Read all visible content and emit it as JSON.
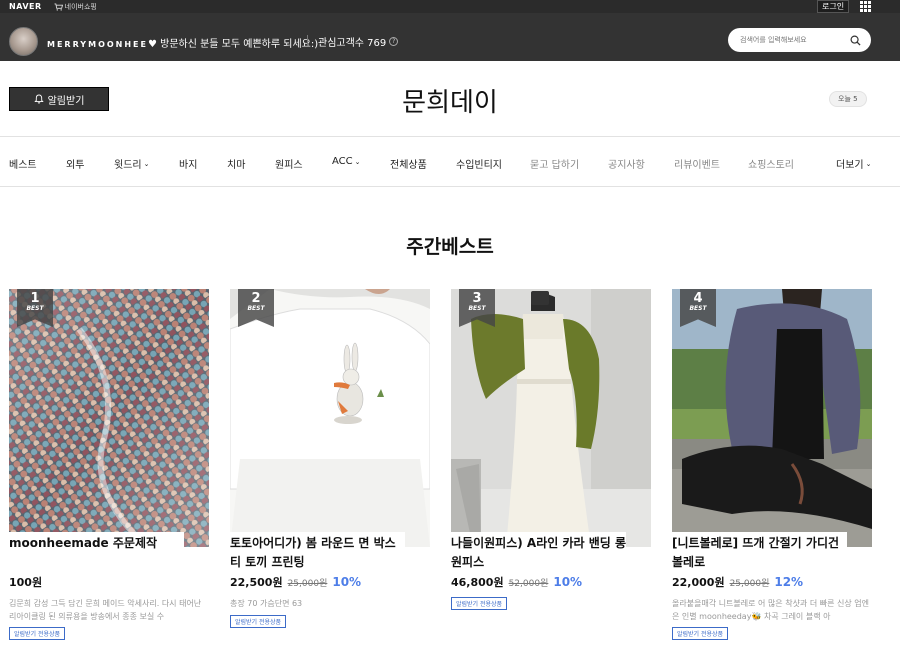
{
  "naver_bar": {
    "logo": "NAVER",
    "shopping": "네이버쇼핑",
    "login": "로그인"
  },
  "profile": {
    "store_id": "MERRYMOONHEE",
    "greeting": "♥ 방문하신 분들 모두 예쁜하루 되세요:)",
    "visitors_label": "관심고객수 769",
    "search_placeholder": "검색어를 입력해보세요"
  },
  "header": {
    "alarm_label": "알림받기",
    "title": "문희데이",
    "today_label": "오늘 5"
  },
  "nav": {
    "items": [
      {
        "label": "베스트",
        "dropdown": false,
        "muted": false
      },
      {
        "label": "외투",
        "dropdown": false,
        "muted": false
      },
      {
        "label": "윗드리",
        "dropdown": true,
        "muted": false
      },
      {
        "label": "바지",
        "dropdown": false,
        "muted": false
      },
      {
        "label": "치마",
        "dropdown": false,
        "muted": false
      },
      {
        "label": "원피스",
        "dropdown": false,
        "muted": false
      },
      {
        "label": "ACC",
        "dropdown": true,
        "muted": false
      },
      {
        "label": "전체상품",
        "dropdown": false,
        "muted": false
      },
      {
        "label": "수입빈티지",
        "dropdown": false,
        "muted": false
      },
      {
        "label": "묻고 답하기",
        "dropdown": false,
        "muted": true
      },
      {
        "label": "공지사항",
        "dropdown": false,
        "muted": true
      },
      {
        "label": "리뷰이벤트",
        "dropdown": false,
        "muted": true
      },
      {
        "label": "쇼핑스토리",
        "dropdown": false,
        "muted": true
      }
    ],
    "more_label": "더보기"
  },
  "section": {
    "title": "주간베스트"
  },
  "products": [
    {
      "rank": "1",
      "badge": "BEST",
      "name": "moonheemade 주문제작",
      "price": "100원",
      "original_price": "",
      "discount": "",
      "description": "김문희 감성 그득 담긴 문희 메이드 악세사리. 다시 태어난 리아이클링 된 의류용을 방송에서 종종 보실 수",
      "tag": "알림받기 전용상품"
    },
    {
      "rank": "2",
      "badge": "BEST",
      "name": "토토아어디가) 봄 라운드 면 박스티 토끼 프린팅",
      "price": "22,500원",
      "original_price": "25,000원",
      "discount": "10%",
      "description": "총장 70 가슴단면 63",
      "tag": "알림받기 전용상품"
    },
    {
      "rank": "3",
      "badge": "BEST",
      "name": "나들이원피스) A라인 카라 밴딩 롱 원피스",
      "price": "46,800원",
      "original_price": "52,000원",
      "discount": "10%",
      "description": "",
      "tag": "알림받기 전용상품"
    },
    {
      "rank": "4",
      "badge": "BEST",
      "name": "[니트볼레로] 뜨개 간절기 가디건 볼레로",
      "price": "22,000원",
      "original_price": "25,000원",
      "discount": "12%",
      "description": "올라붙을매각 니트볼레로 어 많은 착샷과 더 빠른 신상 업엔은 인별 moonheeday🐝 차곡 그레이 블랙 아",
      "tag": "알림받기 전용상품"
    }
  ]
}
